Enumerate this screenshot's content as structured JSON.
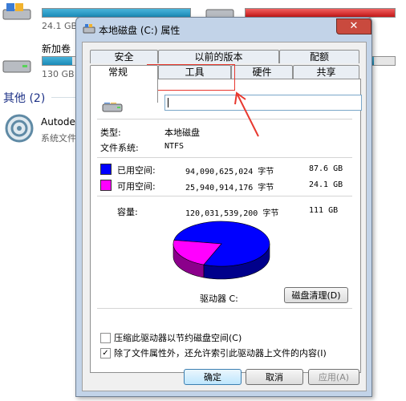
{
  "explorer": {
    "drive1_text": "24.1 GB",
    "drive2_name": "新加卷",
    "drive2_text": "130 GB",
    "group_label": "其他 (2)",
    "app_name": "Autode",
    "app_sub": "系统文件"
  },
  "dialog": {
    "title": "本地磁盘 (C:) 属性",
    "close_glyph": "✕",
    "tabs_row1": [
      "安全",
      "以前的版本",
      "配额"
    ],
    "tabs_row2": [
      "常规",
      "工具",
      "硬件",
      "共享"
    ],
    "type_label": "类型:",
    "type_value": "本地磁盘",
    "fs_label": "文件系统:",
    "fs_value": "NTFS",
    "used_label": "已用空间:",
    "used_bytes": "94,090,625,024 字节",
    "used_gb": "87.6 GB",
    "free_label": "可用空间:",
    "free_bytes": "25,940,914,176 字节",
    "free_gb": "24.1 GB",
    "cap_label": "容量:",
    "cap_bytes": "120,031,539,200 字节",
    "cap_gb": "111 GB",
    "drive_label": "驱动器 C:",
    "cleanup_label": "磁盘清理(D)",
    "compress_label": "压缩此驱动器以节约磁盘空间(C)",
    "index_label": "除了文件属性外，还允许索引此驱动器上文件的内容(I)",
    "index_checked": "✓",
    "ok_label": "确定",
    "cancel_label": "取消",
    "apply_label": "应用(A)"
  },
  "colors": {
    "used": "#0000ff",
    "free": "#ff00ff",
    "used_side": "#00008b",
    "free_side": "#8b008b"
  },
  "used_fraction": 0.784
}
